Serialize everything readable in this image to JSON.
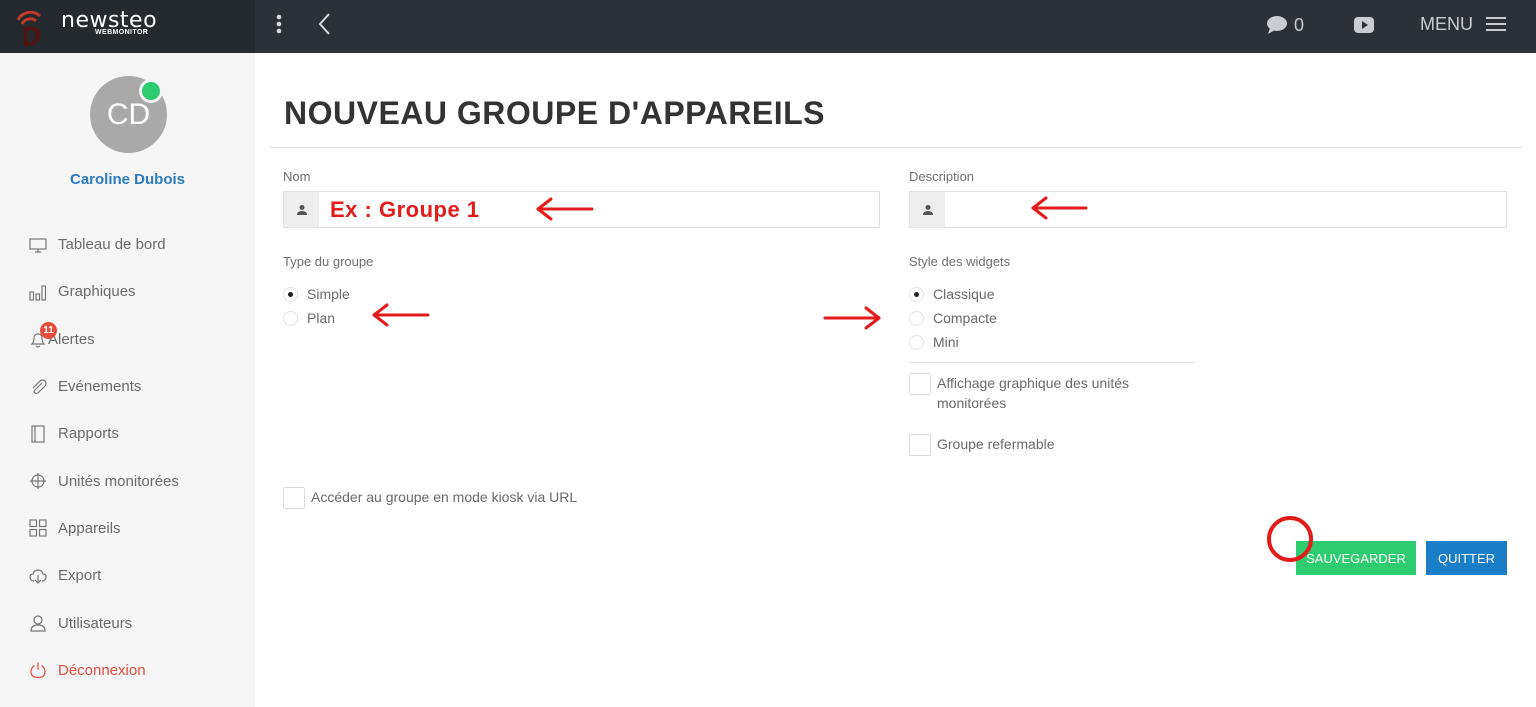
{
  "topbar": {
    "brand_name": "newsteo",
    "brand_sub": "WEBMONITOR",
    "message_count": "0",
    "menu_label": "MENU"
  },
  "sidebar": {
    "avatar_initials": "CD",
    "user_name": "Caroline Dubois",
    "alerts_badge": "11",
    "items": [
      {
        "label": "Tableau de bord",
        "icon": "monitor-icon"
      },
      {
        "label": "Graphiques",
        "icon": "bar-chart-icon"
      },
      {
        "label": "Alertes",
        "icon": "bell-icon"
      },
      {
        "label": "Evénements",
        "icon": "paperclip-icon"
      },
      {
        "label": "Rapports",
        "icon": "notebook-icon"
      },
      {
        "label": "Unités monitorées",
        "icon": "crosshair-icon"
      },
      {
        "label": "Appareils",
        "icon": "grid-icon"
      },
      {
        "label": "Export",
        "icon": "cloud-download-icon"
      },
      {
        "label": "Utilisateurs",
        "icon": "user-icon"
      },
      {
        "label": "Déconnexion",
        "icon": "power-icon"
      }
    ]
  },
  "main": {
    "title": "NOUVEAU GROUPE D'APPAREILS",
    "nom_label": "Nom",
    "nom_value": "",
    "description_label": "Description",
    "description_value": "",
    "type_label": "Type du groupe",
    "type_options": [
      "Simple",
      "Plan"
    ],
    "type_selected": "Simple",
    "style_label": "Style des widgets",
    "style_options": [
      "Classique",
      "Compacte",
      "Mini"
    ],
    "style_selected": "Classique",
    "checkbox_graphique": "Affichage graphique des unités monitorées",
    "checkbox_refermable": "Groupe refermable",
    "checkbox_kiosk": "Accéder au groupe en mode kiosk via URL",
    "save_label": "SAUVEGARDER",
    "quit_label": "QUITTER"
  },
  "annotation": {
    "example_text": "Ex : Groupe 1",
    "color": "#e21b1b"
  },
  "colors": {
    "topbar": "#2b3137",
    "accent_blue": "#2a7bbf",
    "save_green": "#2ecc71",
    "quit_blue": "#1a7dc8",
    "logout_red": "#e74c3c"
  }
}
